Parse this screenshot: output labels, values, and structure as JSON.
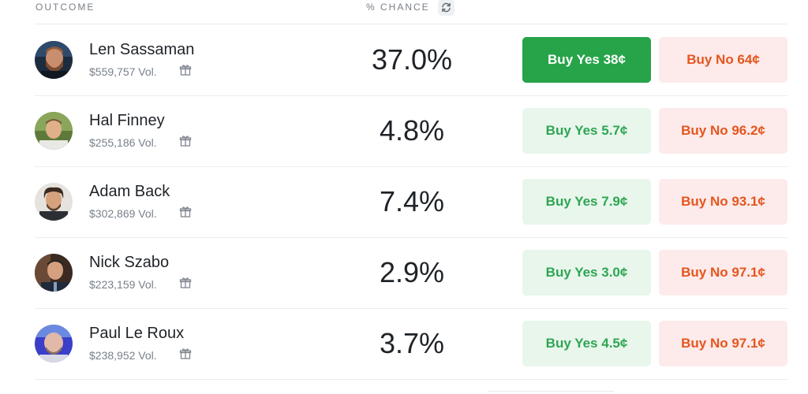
{
  "header": {
    "outcome_label": "OUTCOME",
    "chance_label": "% CHANCE"
  },
  "icons": {
    "refresh": "refresh-icon",
    "gift": "gift-icon"
  },
  "colors": {
    "yes_primary_bg": "#27a349",
    "yes_bg": "#e8f6ec",
    "yes_text": "#2fa552",
    "no_bg": "#fdeaea",
    "no_text": "#e4561e"
  },
  "outcomes": [
    {
      "name": "Len Sassaman",
      "volume": "$559,757 Vol.",
      "chance": "37.0%",
      "buy_yes": "Buy Yes 38¢",
      "buy_no": "Buy No 64¢"
    },
    {
      "name": "Hal Finney",
      "volume": "$255,186 Vol.",
      "chance": "4.8%",
      "buy_yes": "Buy Yes 5.7¢",
      "buy_no": "Buy No 96.2¢"
    },
    {
      "name": "Adam Back",
      "volume": "$302,869 Vol.",
      "chance": "7.4%",
      "buy_yes": "Buy Yes 7.9¢",
      "buy_no": "Buy No 93.1¢"
    },
    {
      "name": "Nick Szabo",
      "volume": "$223,159 Vol.",
      "chance": "2.9%",
      "buy_yes": "Buy Yes 3.0¢",
      "buy_no": "Buy No 97.1¢"
    },
    {
      "name": "Paul Le Roux",
      "volume": "$238,952 Vol.",
      "chance": "3.7%",
      "buy_yes": "Buy Yes 4.5¢",
      "buy_no": "Buy No 97.1¢"
    }
  ]
}
